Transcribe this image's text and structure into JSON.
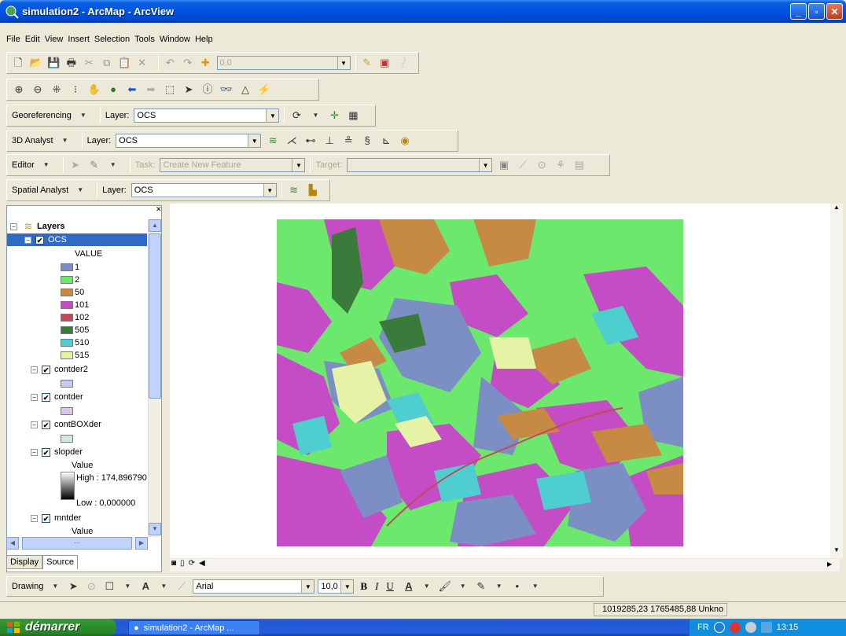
{
  "window": {
    "title": "simulation2 - ArcMap - ArcView",
    "min": "_",
    "max": "▫",
    "close": "✕"
  },
  "menu": [
    "File",
    "Edit",
    "View",
    "Insert",
    "Selection",
    "Tools",
    "Window",
    "Help"
  ],
  "standard_toolbar": {
    "scale_value": "0.0"
  },
  "georef": {
    "label": "Georeferencing",
    "layer_label": "Layer:",
    "layer_value": "OCS"
  },
  "analyst3d": {
    "label": "3D Analyst",
    "layer_label": "Layer:",
    "layer_value": "OCS"
  },
  "editor": {
    "label": "Editor",
    "task_label": "Task:",
    "task_value": "Create New Feature",
    "target_label": "Target:"
  },
  "spatial": {
    "label": "Spatial Analyst",
    "layer_label": "Layer:",
    "layer_value": "OCS"
  },
  "toc": {
    "root": "Layers",
    "ocs_name": "OCS",
    "ocs_field": "VALUE",
    "legend": [
      {
        "label": "1",
        "color": "#7b8fc4"
      },
      {
        "label": "2",
        "color": "#6ce86c"
      },
      {
        "label": "50",
        "color": "#c68a45"
      },
      {
        "label": "101",
        "color": "#c44cc4"
      },
      {
        "label": "102",
        "color": "#c44a5a"
      },
      {
        "label": "505",
        "color": "#3a7a3a"
      },
      {
        "label": "510",
        "color": "#4ecece"
      },
      {
        "label": "515",
        "color": "#e6f2a6"
      }
    ],
    "contder2": {
      "name": "contder2",
      "color": "#c8c8ec"
    },
    "contder": {
      "name": "contder",
      "color": "#d8c8ec"
    },
    "contboxder": {
      "name": "contBOXder",
      "color": "#d0ecd8"
    },
    "slopder": {
      "name": "slopder",
      "field": "Value",
      "high": "High : 174,896790",
      "low": "Low : 0,000000"
    },
    "mntder": {
      "name": "mntder",
      "field": "Value"
    },
    "tab_display": "Display",
    "tab_source": "Source"
  },
  "drawing": {
    "label": "Drawing",
    "font": "Arial",
    "size": "10,0",
    "bold": "B",
    "italic": "I",
    "underline": "U",
    "font_color": "A"
  },
  "status": {
    "coords": "1019285,23  1765485,88 Unkno"
  },
  "taskbar": {
    "start": "démarrer",
    "task": "simulation2 - ArcMap ...",
    "lang": "FR",
    "time": "13:15"
  },
  "map_colors": {
    "cls_1": "#7b8fc4",
    "cls_2": "#6ce86c",
    "cls_50": "#c68a45",
    "cls_101": "#c44cc4",
    "cls_102": "#c44a5a",
    "cls_505": "#3a7a3a",
    "cls_510": "#4ecece",
    "cls_515": "#e6f2a6"
  }
}
